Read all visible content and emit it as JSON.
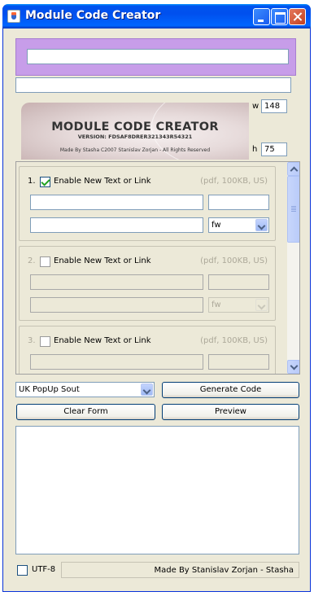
{
  "window": {
    "title": "Module Code Creator"
  },
  "logo": {
    "title": "MODULE CODE CREATOR",
    "version": "VERSION:  FDSAF8DRER321343R54321",
    "credit": "Made By Stasha C2007 Stanislav Zorjan  - All Rights Reserved"
  },
  "dims": {
    "w_label": "w",
    "w_value": "148",
    "h_label": "h",
    "h_value": "75"
  },
  "groups": [
    {
      "number": "1.",
      "label": "Enable New Text or Link",
      "hint": "(pdf, 100KB, US)",
      "select": "fw",
      "checked": true,
      "enabled": true
    },
    {
      "number": "2.",
      "label": "Enable New Text or Link",
      "hint": "(pdf, 100KB, US)",
      "select": "fw",
      "checked": false,
      "enabled": false
    },
    {
      "number": "3.",
      "label": "Enable New Text or Link",
      "hint": "(pdf, 100KB, US)",
      "select": "",
      "checked": false,
      "enabled": false
    }
  ],
  "controls": {
    "combo_value": "UK PopUp Sout",
    "generate_label": "Generate Code",
    "clear_label": "Clear Form",
    "preview_label": "Preview"
  },
  "footer": {
    "utf_label": "UTF-8",
    "status": "Made By Stanislav Zorjan - Stasha"
  },
  "colors": {
    "window_bg": "#ece9d8",
    "title_bar": "#0055ea",
    "lilac_panel": "#c79de9"
  }
}
